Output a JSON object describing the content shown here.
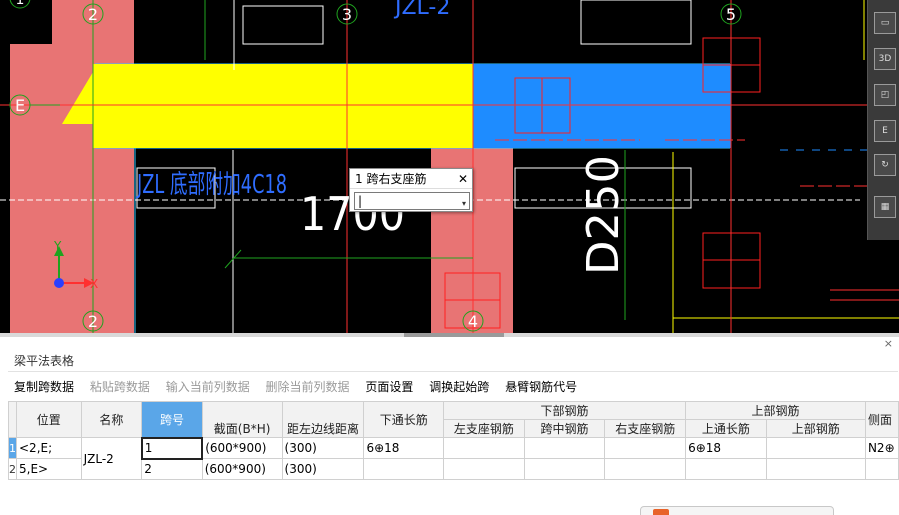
{
  "cad": {
    "axis_labels": [
      "1",
      "2",
      "3",
      "5",
      "E",
      "E",
      "2",
      "4"
    ],
    "beam_label": "JZL 底部附加4C18",
    "top_beam_label": "JZL-2",
    "dim_text": "1700",
    "vertical_text": "D250",
    "ucs_y": "Y",
    "ucs_x": "X"
  },
  "colors": {
    "background": "#000000",
    "column": "#e87474",
    "beam_yellow": "#ffff00",
    "beam_blue": "#1e8cff",
    "axis_green": "#1fa31f",
    "axis_red": "#ff3030",
    "text_blue": "#2f6dff",
    "selection": "#5aa6e8"
  },
  "popup": {
    "title": "1 跨右支座筋",
    "close": "✕",
    "value": "|",
    "arrow": "▾"
  },
  "panel": {
    "title": "梁平法表格",
    "close": "×",
    "toolbar": [
      {
        "label": "复制跨数据",
        "enabled": true
      },
      {
        "label": "粘贴跨数据",
        "enabled": false
      },
      {
        "label": "输入当前列数据",
        "enabled": false
      },
      {
        "label": "删除当前列数据",
        "enabled": false
      },
      {
        "label": "页面设置",
        "enabled": true
      },
      {
        "label": "调换起始跨",
        "enabled": true
      },
      {
        "label": "悬臂钢筋代号",
        "enabled": true
      }
    ]
  },
  "table": {
    "headers": {
      "position": "位置",
      "name": "名称",
      "span": "跨号",
      "section": "截面(B*H)",
      "edge_dist": "距左边线距离",
      "bottom_through": "下通长筋",
      "group_bottom": "下部钢筋",
      "left_support": "左支座钢筋",
      "mid_span": "跨中钢筋",
      "right_support": "右支座钢筋",
      "group_top": "上部钢筋",
      "top_through": "上通长筋",
      "top_bars": "上部钢筋",
      "side": "侧面"
    },
    "rows": [
      {
        "num": "1",
        "position": "<2,E;",
        "name": "JZL-2",
        "span": "1",
        "section": "(600*900)",
        "edge_dist": "(300)",
        "bottom_through": "6⊕18",
        "left_support": "",
        "mid_span": "",
        "right_support": "",
        "top_through": "6⊕18",
        "top_bars": "",
        "side": "N2⊕"
      },
      {
        "num": "2",
        "position": "5,E>",
        "name": "",
        "span": "2",
        "section": "(600*900)",
        "edge_dist": "(300)",
        "bottom_through": "",
        "left_support": "",
        "mid_span": "",
        "right_support": "",
        "top_through": "",
        "top_bars": "",
        "side": ""
      }
    ]
  },
  "viewbar": {
    "icons": [
      "view-top-icon",
      "view-3d-icon",
      "view-cube-icon",
      "rotate-icon",
      "grid-icon"
    ],
    "label_e": "E"
  }
}
